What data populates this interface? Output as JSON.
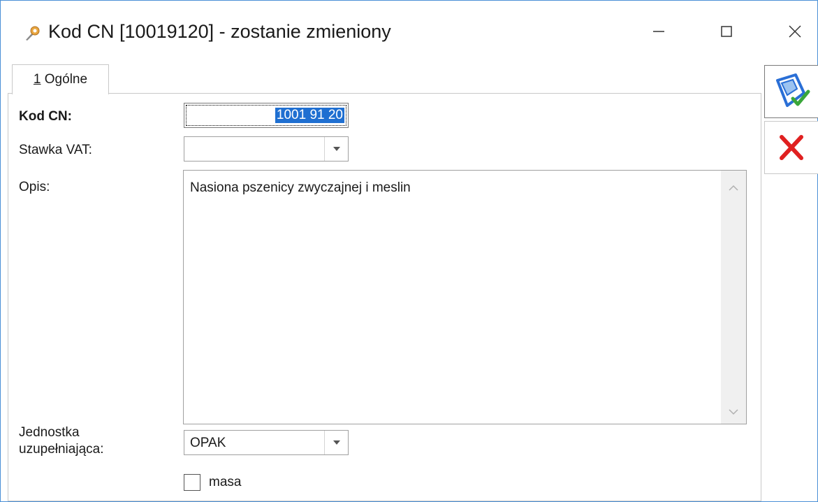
{
  "window": {
    "title": "Kod CN [10019120] - zostanie zmieniony"
  },
  "tabs": [
    {
      "number": "1",
      "label": "Ogólne"
    }
  ],
  "form": {
    "kod_cn": {
      "label": "Kod CN:",
      "value": "1001 91 20"
    },
    "stawka_vat": {
      "label": "Stawka VAT:",
      "value": ""
    },
    "opis": {
      "label": "Opis:",
      "value": "Nasiona pszenicy zwyczajnej i meslin"
    },
    "jednostka": {
      "label_line1": "Jednostka",
      "label_line2": "uzupełniająca:",
      "value": "OPAK"
    },
    "masa": {
      "label": "masa",
      "checked": false
    }
  },
  "icons": {
    "app": "app-icon",
    "save": "save-confirm-icon",
    "cancel": "cancel-icon"
  },
  "colors": {
    "selection": "#1f6fd1",
    "window_border": "#4a8fd6",
    "cancel_red": "#e02020",
    "save_blue": "#2a6fd6",
    "save_check_green": "#3aa63a"
  }
}
